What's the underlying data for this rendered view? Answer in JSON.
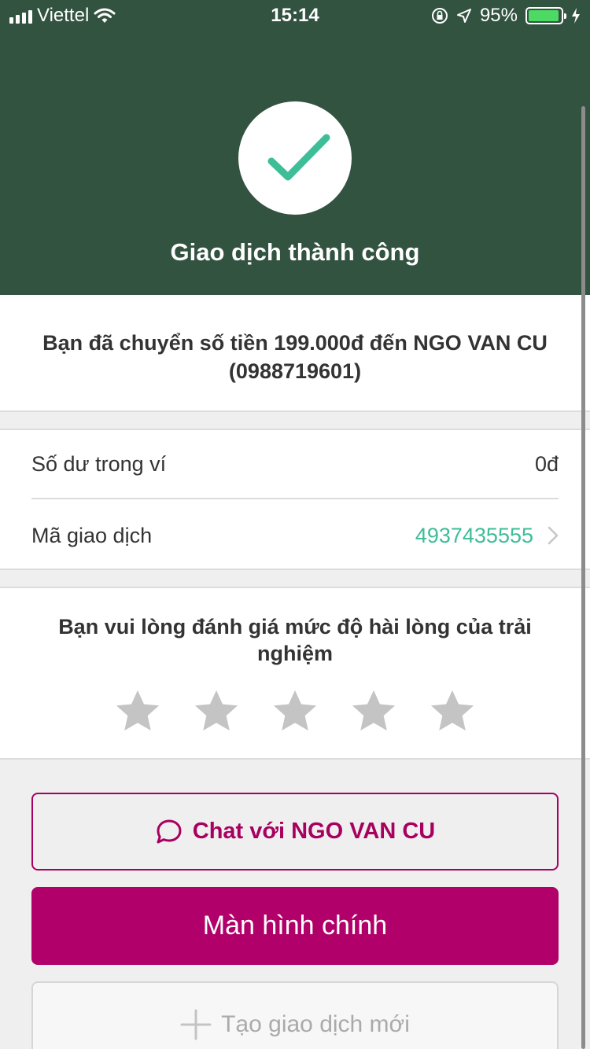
{
  "status_bar": {
    "carrier": "Viettel",
    "time": "15:14",
    "battery_percent": "95%",
    "battery_level": 0.95
  },
  "header": {
    "title": "Giao dịch thành công",
    "icon": "check-icon",
    "background_color": "#335341"
  },
  "message": "Bạn đã chuyển số tiền 199.000đ đến NGO VAN CU (0988719601)",
  "info": {
    "balance_label": "Số dư trong ví",
    "balance_value": "0đ",
    "tx_label": "Mã giao dịch",
    "tx_value": "4937435555"
  },
  "rating": {
    "prompt": "Bạn vui lòng đánh giá mức độ hài lòng của trải nghiệm",
    "max_stars": 5,
    "selected_stars": 0
  },
  "buttons": {
    "chat": "Chat với NGO VAN CU",
    "main": "Màn hình chính",
    "new_tx": "Tạo giao dịch mới"
  },
  "colors": {
    "accent": "#b10069",
    "success": "#3dbd98",
    "header": "#335341"
  }
}
